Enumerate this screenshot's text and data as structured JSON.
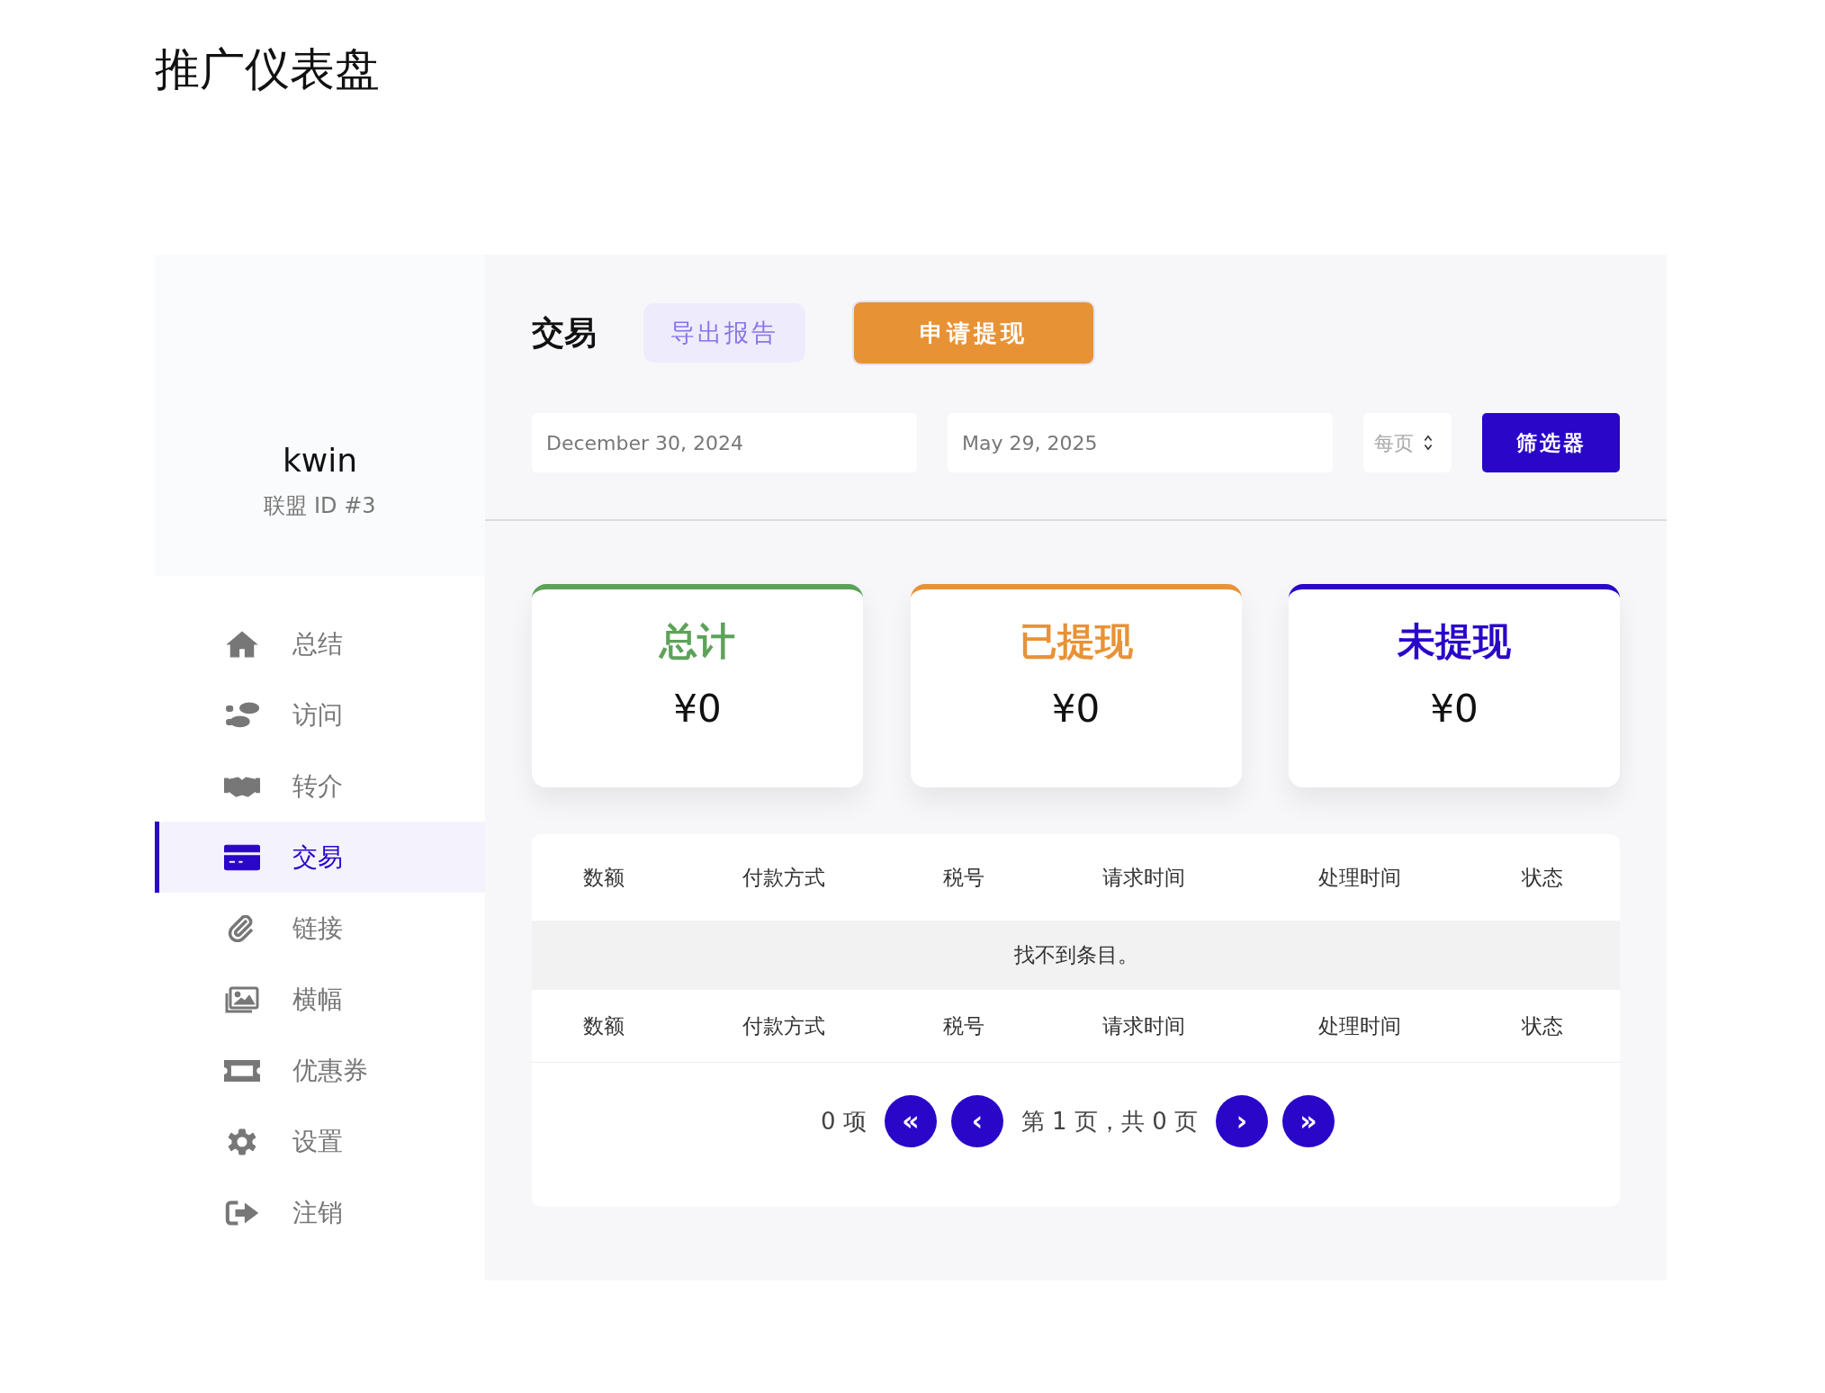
{
  "page_title": "推广仪表盘",
  "profile": {
    "name": "kwin",
    "affiliate_id": "联盟 ID #3"
  },
  "sidebar": {
    "items": [
      {
        "label": "总结",
        "selected": false
      },
      {
        "label": "访问",
        "selected": false
      },
      {
        "label": "转介",
        "selected": false
      },
      {
        "label": "交易",
        "selected": true
      },
      {
        "label": "链接",
        "selected": false
      },
      {
        "label": "横幅",
        "selected": false
      },
      {
        "label": "优惠券",
        "selected": false
      },
      {
        "label": "设置",
        "selected": false
      },
      {
        "label": "注销",
        "selected": false
      }
    ]
  },
  "header": {
    "title": "交易",
    "export_button": "导出报告",
    "withdraw_button": "申请提现"
  },
  "filters": {
    "start_date": "December 30, 2024",
    "end_date": "May 29, 2025",
    "per_page": {
      "placeholder": "每页"
    },
    "filter_button": "筛选器"
  },
  "stats": [
    {
      "label": "总计",
      "value": "¥0",
      "color": "#5ea25a"
    },
    {
      "label": "已提现",
      "value": "¥0",
      "color": "#e89236"
    },
    {
      "label": "未提现",
      "value": "¥0",
      "color": "#2a06c9"
    }
  ],
  "table": {
    "columns": [
      "数额",
      "付款方式",
      "税号",
      "请求时间",
      "处理时间",
      "状态"
    ],
    "empty_message": "找不到条目。",
    "footer_columns": [
      "数额",
      "付款方式",
      "税号",
      "请求时间",
      "处理时间",
      "状态"
    ]
  },
  "pagination": {
    "count": "0 项",
    "first": "«",
    "prev": "‹",
    "page_info": "第 1 页，共 0 页",
    "next": "›",
    "last": "»"
  }
}
